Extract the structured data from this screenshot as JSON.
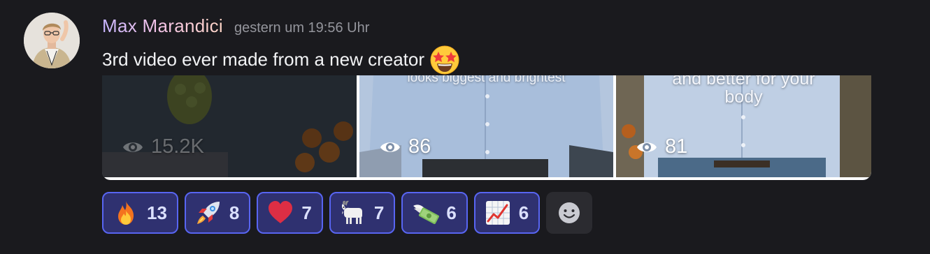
{
  "message": {
    "author": "Max Marandici",
    "timestamp": "gestern um 19:56 Uhr",
    "text": "3rd video ever made from a new creator",
    "text_emoji": "star-struck"
  },
  "videos": [
    {
      "caption": "",
      "views": "15.2K"
    },
    {
      "caption": "looks biggest and brightest",
      "views": "86"
    },
    {
      "caption": "and better for your\nbody",
      "views": "81"
    }
  ],
  "reactions": [
    {
      "icon": "fire",
      "count": "13"
    },
    {
      "icon": "rocket",
      "count": "8"
    },
    {
      "icon": "red-heart",
      "count": "7"
    },
    {
      "icon": "goat",
      "count": "7"
    },
    {
      "icon": "money-with-wings",
      "count": "6"
    },
    {
      "icon": "chart-increasing",
      "count": "6"
    }
  ],
  "colors": {
    "background": "#1a1a1e",
    "reaction_border": "#5865f2",
    "reaction_fill": "#2f3170",
    "timestamp": "#94959c"
  }
}
